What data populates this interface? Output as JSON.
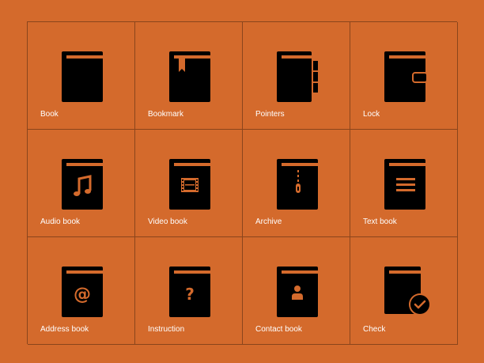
{
  "colors": {
    "background": "#d46a2c",
    "icon": "#000000",
    "icon_detail": "#d46a2c",
    "label": "#ffffff"
  },
  "icons": [
    {
      "id": "book",
      "label": "Book",
      "icon": "book-icon"
    },
    {
      "id": "bookmark",
      "label": "Bookmark",
      "icon": "bookmark-icon"
    },
    {
      "id": "pointers",
      "label": "Pointers",
      "icon": "pointers-icon"
    },
    {
      "id": "lock",
      "label": "Lock",
      "icon": "lock-icon"
    },
    {
      "id": "audio-book",
      "label": "Audio book",
      "icon": "audio-book-icon"
    },
    {
      "id": "video-book",
      "label": "Video book",
      "icon": "video-book-icon"
    },
    {
      "id": "archive",
      "label": "Archive",
      "icon": "archive-icon"
    },
    {
      "id": "text-book",
      "label": "Text book",
      "icon": "text-book-icon"
    },
    {
      "id": "address-book",
      "label": "Address book",
      "icon": "address-book-icon"
    },
    {
      "id": "instruction",
      "label": "Instruction",
      "icon": "instruction-icon"
    },
    {
      "id": "contact-book",
      "label": "Contact book",
      "icon": "contact-book-icon"
    },
    {
      "id": "check",
      "label": "Check",
      "icon": "check-icon"
    }
  ]
}
